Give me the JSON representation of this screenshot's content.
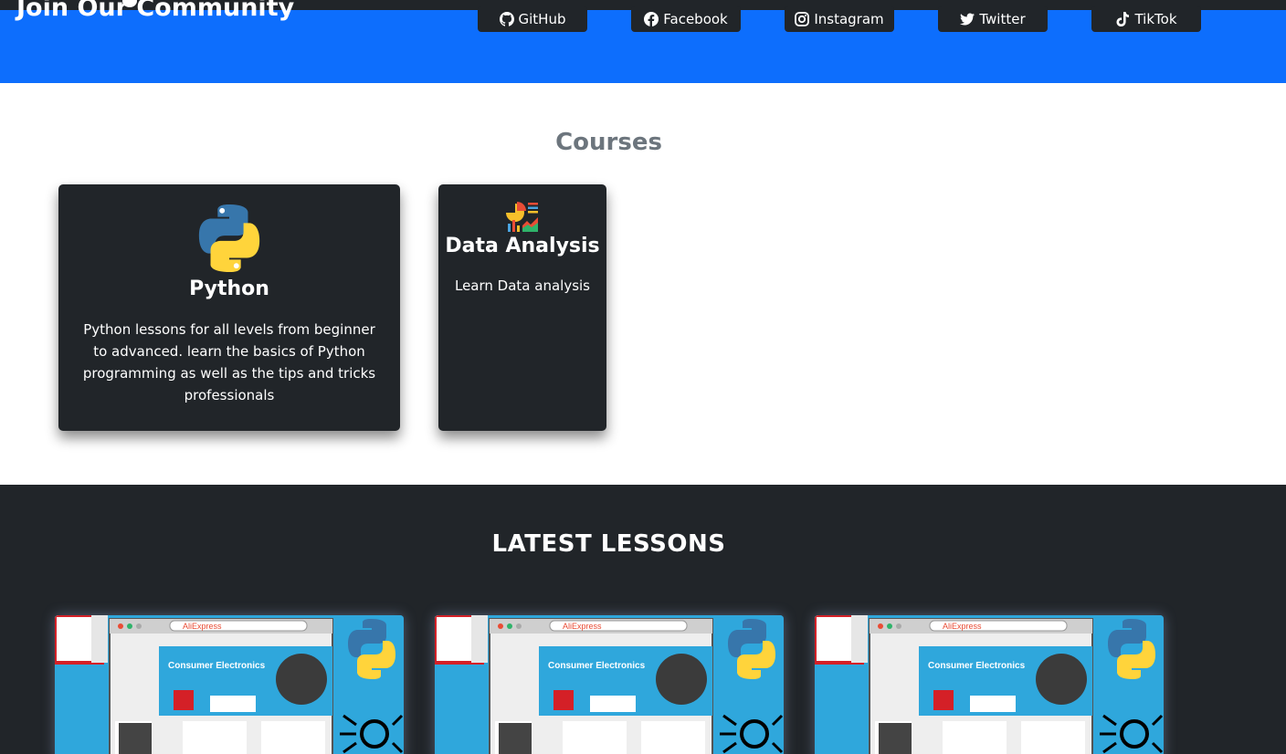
{
  "community": {
    "title": "Join Our Community",
    "links": [
      {
        "label": "GitHub",
        "icon": "github-icon"
      },
      {
        "label": "Facebook",
        "icon": "facebook-icon"
      },
      {
        "label": "Instagram",
        "icon": "instagram-icon"
      },
      {
        "label": "Twitter",
        "icon": "twitter-icon"
      },
      {
        "label": "TikTok",
        "icon": "tiktok-icon"
      }
    ]
  },
  "courses": {
    "title": "Courses",
    "items": [
      {
        "title": "Python",
        "description": "Python lessons for all levels from beginner to advanced. learn the basics of Python programming as well as the tips and tricks professionals",
        "icon": "python-logo-icon"
      },
      {
        "title": "Data Analysis",
        "description": "Learn Data analysis",
        "icon": "data-analysis-icon"
      }
    ]
  },
  "lessons": {
    "title": "LATEST LESSONS",
    "thumbnails": [
      {
        "brand": "AliExpress",
        "heading": "Consumer Electronics"
      },
      {
        "brand": "AliExpress",
        "heading": "Consumer Electronics"
      },
      {
        "brand": "AliExpress",
        "heading": "Consumer Electronics"
      }
    ]
  },
  "colors": {
    "primary_blue": "#0d6efd",
    "dark": "#212529",
    "muted": "#6c757d"
  }
}
